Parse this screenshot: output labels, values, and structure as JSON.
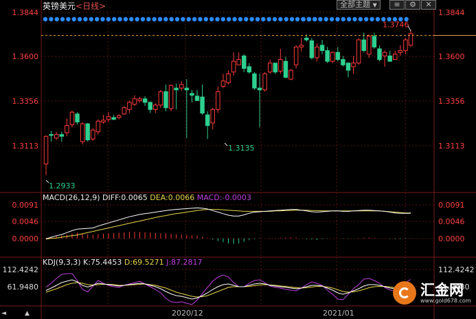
{
  "header": {
    "instrument": "英镑美元",
    "period": "<日线>",
    "menu_label": "全部主题",
    "menu_arrow": "▼"
  },
  "colors": {
    "up": "#ff3b3b",
    "down": "#2ecf8f",
    "axis_text": "#ff4040",
    "grid": "#5a1414",
    "white_line": "#ffffff",
    "yellow_line": "#e8d84a",
    "purple_line": "#c040e0",
    "dot": "#2a8cff"
  },
  "price_axis_labels": [
    "1.3844",
    "1.3600",
    "1.3356",
    "1.3113"
  ],
  "macd": {
    "label": "MACD(26,12,9)",
    "diff": "DIFF:0.0065",
    "dea": "DEA:0.0066",
    "macd": "MACD:-0.0003",
    "axis_labels": [
      "0.0091",
      "0.0046",
      "0.0000"
    ]
  },
  "kdj": {
    "label": "KDJ(9,3,3)",
    "k": "K:75.4453",
    "d": "D:69.5271",
    "j": "J:87.2817",
    "axis_labels": [
      "112.4242",
      "61.9480"
    ]
  },
  "dates": [
    "2020/12",
    "2021/01"
  ],
  "logo": {
    "name": "汇金网",
    "url": "www.gold678.com"
  },
  "chart_data": {
    "type": "candlestick",
    "title": "英镑美元 <日线>",
    "ylim": [
      1.2893,
      1.3844
    ],
    "annotations": {
      "high": "1.3746",
      "low": "1.2933",
      "local_low": "1.3135"
    },
    "ohlc": [
      [
        1.2995,
        1.315,
        1.2933,
        1.3155
      ],
      [
        1.316,
        1.3155,
        1.312,
        1.318
      ],
      [
        1.314,
        1.316,
        1.313,
        1.3175
      ],
      [
        1.316,
        1.315,
        1.312,
        1.3175
      ],
      [
        1.317,
        1.321,
        1.315,
        1.325
      ],
      [
        1.3215,
        1.3285,
        1.32,
        1.3295
      ],
      [
        1.3275,
        1.323,
        1.3215,
        1.3285
      ],
      [
        1.312,
        1.322,
        1.3105,
        1.323
      ],
      [
        1.322,
        1.313,
        1.312,
        1.3225
      ],
      [
        1.3135,
        1.3185,
        1.3125,
        1.3195
      ],
      [
        1.3175,
        1.3235,
        1.316,
        1.3245
      ],
      [
        1.323,
        1.324,
        1.322,
        1.327
      ],
      [
        1.3245,
        1.326,
        1.323,
        1.3285
      ],
      [
        1.3255,
        1.3245,
        1.324,
        1.327
      ],
      [
        1.3255,
        1.3265,
        1.3245,
        1.3275
      ],
      [
        1.3275,
        1.331,
        1.327,
        1.332
      ],
      [
        1.33,
        1.334,
        1.328,
        1.335
      ],
      [
        1.333,
        1.336,
        1.332,
        1.338
      ],
      [
        1.335,
        1.336,
        1.334,
        1.337
      ],
      [
        1.336,
        1.334,
        1.332,
        1.3375
      ],
      [
        1.334,
        1.33,
        1.328,
        1.3345
      ],
      [
        1.33,
        1.3325,
        1.328,
        1.3335
      ],
      [
        1.3325,
        1.34,
        1.331,
        1.341
      ],
      [
        1.34,
        1.331,
        1.329,
        1.344
      ],
      [
        1.3305,
        1.3435,
        1.329,
        1.344
      ],
      [
        1.342,
        1.341,
        1.33,
        1.3445
      ],
      [
        1.342,
        1.344,
        1.3405,
        1.346
      ],
      [
        1.342,
        1.341,
        1.314,
        1.347
      ],
      [
        1.339,
        1.338,
        1.334,
        1.341
      ],
      [
        1.3375,
        1.335,
        1.336,
        1.341
      ],
      [
        1.337,
        1.328,
        1.327,
        1.344
      ],
      [
        1.327,
        1.321,
        1.3135,
        1.329
      ],
      [
        1.3225,
        1.33,
        1.319,
        1.331
      ],
      [
        1.33,
        1.34,
        1.328,
        1.343
      ],
      [
        1.343,
        1.346,
        1.342,
        1.35
      ],
      [
        1.345,
        1.35,
        1.344,
        1.352
      ],
      [
        1.351,
        1.357,
        1.349,
        1.362
      ],
      [
        1.355,
        1.358,
        1.356,
        1.362
      ],
      [
        1.36,
        1.353,
        1.351,
        1.361
      ],
      [
        1.354,
        1.351,
        1.35,
        1.356
      ],
      [
        1.35,
        1.342,
        1.341,
        1.351
      ],
      [
        1.342,
        1.341,
        1.32,
        1.35
      ],
      [
        1.341,
        1.35,
        1.34,
        1.351
      ],
      [
        1.351,
        1.356,
        1.35,
        1.358
      ],
      [
        1.356,
        1.351,
        1.35,
        1.356
      ],
      [
        1.3515,
        1.358,
        1.35,
        1.364
      ],
      [
        1.357,
        1.348,
        1.3475,
        1.3595
      ],
      [
        1.347,
        1.352,
        1.3465,
        1.3525
      ],
      [
        1.355,
        1.365,
        1.353,
        1.366
      ],
      [
        1.365,
        1.366,
        1.3625,
        1.37
      ],
      [
        1.37,
        1.369,
        1.368,
        1.372
      ],
      [
        1.3685,
        1.359,
        1.358,
        1.37
      ],
      [
        1.359,
        1.365,
        1.357,
        1.367
      ],
      [
        1.366,
        1.363,
        1.361,
        1.369
      ],
      [
        1.363,
        1.357,
        1.356,
        1.365
      ],
      [
        1.357,
        1.362,
        1.356,
        1.3625
      ],
      [
        1.362,
        1.358,
        1.357,
        1.365
      ],
      [
        1.358,
        1.355,
        1.354,
        1.36
      ],
      [
        1.356,
        1.352,
        1.348,
        1.3565
      ],
      [
        1.354,
        1.356,
        1.35,
        1.36
      ],
      [
        1.356,
        1.369,
        1.355,
        1.37
      ],
      [
        1.369,
        1.363,
        1.362,
        1.373
      ],
      [
        1.361,
        1.371,
        1.359,
        1.372
      ],
      [
        1.371,
        1.365,
        1.364,
        1.373
      ],
      [
        1.364,
        1.358,
        1.357,
        1.366
      ],
      [
        1.36,
        1.362,
        1.354,
        1.363
      ],
      [
        1.36,
        1.357,
        1.358,
        1.363
      ],
      [
        1.358,
        1.361,
        1.358,
        1.363
      ],
      [
        1.362,
        1.363,
        1.36,
        1.366
      ],
      [
        1.363,
        1.369,
        1.361,
        1.37
      ],
      [
        1.366,
        1.3725,
        1.365,
        1.3746
      ]
    ],
    "macd_ylim": [
      -0.0045,
      0.0101
    ],
    "macd_diff": [
      -0.0001,
      0.0003,
      0.0007,
      0.001,
      0.0015,
      0.002,
      0.0024,
      0.0025,
      0.0026,
      0.0027,
      0.0032,
      0.0036,
      0.004,
      0.0044,
      0.0048,
      0.0052,
      0.0056,
      0.0059,
      0.0062,
      0.0064,
      0.0066,
      0.0068,
      0.007,
      0.0072,
      0.0074,
      0.0075,
      0.0076,
      0.0077,
      0.0078,
      0.0079,
      0.0078,
      0.0076,
      0.0072,
      0.0068,
      0.0064,
      0.006,
      0.0058,
      0.0058,
      0.0061,
      0.0065,
      0.0068,
      0.0069,
      0.007,
      0.0071,
      0.0072,
      0.0073,
      0.0074,
      0.0075,
      0.0075,
      0.0073,
      0.0071,
      0.0069,
      0.0068,
      0.0069,
      0.007,
      0.0071,
      0.0071,
      0.007,
      0.007,
      0.0071,
      0.0072,
      0.0073,
      0.0073,
      0.0072,
      0.0071,
      0.007,
      0.0068,
      0.0066,
      0.0065,
      0.0065,
      0.0065
    ],
    "macd_dea": [
      -0.0002,
      0.0,
      0.0001,
      0.0003,
      0.0005,
      0.0007,
      0.0009,
      0.0012,
      0.0015,
      0.0018,
      0.0021,
      0.0024,
      0.0027,
      0.003,
      0.0033,
      0.0036,
      0.0039,
      0.0042,
      0.0045,
      0.0048,
      0.0051,
      0.0054,
      0.0057,
      0.0059,
      0.0062,
      0.0064,
      0.0066,
      0.0068,
      0.007,
      0.0072,
      0.0074,
      0.0075,
      0.0075,
      0.0075,
      0.0074,
      0.0073,
      0.0072,
      0.0071,
      0.007,
      0.007,
      0.007,
      0.007,
      0.007,
      0.007,
      0.0071,
      0.0071,
      0.0072,
      0.0072,
      0.0073,
      0.0073,
      0.0073,
      0.0072,
      0.0072,
      0.0071,
      0.0071,
      0.0071,
      0.0071,
      0.0071,
      0.0071,
      0.0071,
      0.0071,
      0.0071,
      0.0071,
      0.0071,
      0.0071,
      0.007,
      0.0069,
      0.0068,
      0.0067,
      0.0066,
      0.0066
    ],
    "macd_hist": [
      0.0001,
      0.0003,
      0.0006,
      0.0007,
      0.001,
      0.0013,
      0.0015,
      0.0013,
      0.0011,
      0.0009,
      0.0011,
      0.0012,
      0.0013,
      0.0014,
      0.0015,
      0.0016,
      0.0017,
      0.0017,
      0.0017,
      0.0016,
      0.0015,
      0.0014,
      0.0013,
      0.0013,
      0.0012,
      0.0011,
      0.001,
      0.0009,
      0.0008,
      0.0007,
      0.0004,
      0.0001,
      -0.0003,
      -0.0007,
      -0.001,
      -0.0013,
      -0.0014,
      -0.0013,
      -0.0009,
      -0.0005,
      -0.0002,
      -0.0001,
      0.0,
      0.0001,
      0.0001,
      0.0002,
      0.0002,
      0.0003,
      0.0002,
      0.0,
      -0.0002,
      -0.0003,
      -0.0004,
      -0.0002,
      -0.0001,
      0.0,
      0.0,
      -0.0001,
      -0.0001,
      0.0,
      0.0001,
      0.0002,
      0.0002,
      0.0001,
      0.0,
      0.0,
      -0.0001,
      -0.0002,
      -0.0002,
      -0.0001,
      -0.0001
    ],
    "kdj_ylim": [
      12,
      140
    ],
    "kdj_k": [
      55,
      62,
      70,
      78,
      82,
      86,
      80,
      70,
      65,
      70,
      76,
      74,
      72,
      70,
      68,
      70,
      72,
      74,
      76,
      74,
      70,
      66,
      60,
      52,
      45,
      40,
      38,
      34,
      30,
      33,
      40,
      48,
      58,
      66,
      72,
      74,
      70,
      66,
      66,
      70,
      74,
      76,
      74,
      70,
      68,
      66,
      64,
      62,
      60,
      62,
      66,
      70,
      70,
      68,
      62,
      56,
      48,
      44,
      48,
      54,
      60,
      68,
      72,
      72,
      70,
      66,
      62,
      60,
      64,
      70,
      75
    ],
    "kdj_d": [
      50,
      55,
      60,
      66,
      72,
      76,
      78,
      76,
      72,
      71,
      72,
      73,
      73,
      72,
      70,
      70,
      71,
      72,
      73,
      74,
      72,
      70,
      66,
      62,
      56,
      50,
      46,
      42,
      38,
      36,
      37,
      40,
      46,
      52,
      58,
      64,
      66,
      66,
      66,
      67,
      69,
      71,
      72,
      71,
      70,
      68,
      67,
      65,
      63,
      62,
      63,
      65,
      67,
      67,
      65,
      62,
      57,
      52,
      50,
      51,
      54,
      58,
      63,
      66,
      67,
      67,
      65,
      63,
      63,
      66,
      69
    ],
    "kdj_j": [
      65,
      76,
      90,
      102,
      104,
      104,
      84,
      58,
      51,
      68,
      84,
      76,
      70,
      66,
      64,
      70,
      74,
      78,
      82,
      74,
      66,
      58,
      48,
      32,
      22,
      20,
      22,
      18,
      14,
      27,
      46,
      64,
      82,
      94,
      100,
      94,
      78,
      66,
      66,
      76,
      84,
      86,
      78,
      68,
      64,
      62,
      58,
      56,
      54,
      62,
      72,
      80,
      76,
      70,
      56,
      44,
      30,
      28,
      44,
      60,
      72,
      88,
      90,
      84,
      76,
      64,
      56,
      54,
      66,
      78,
      87
    ]
  }
}
